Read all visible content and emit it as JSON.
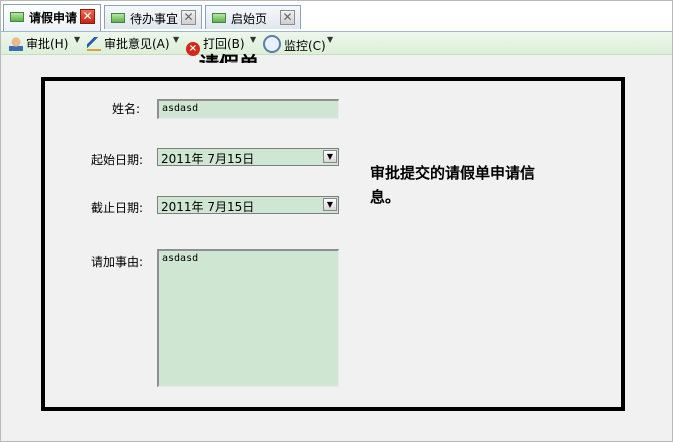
{
  "tabs": [
    {
      "label": "请假申请",
      "close": "✕"
    },
    {
      "label": "待办事宜",
      "close": "✕"
    },
    {
      "label": "启始页",
      "close": "✕"
    }
  ],
  "toolbar": {
    "approve": "审批(H)",
    "opinion": "审批意见(A)",
    "reject": "打回(B)",
    "monitor": "监控(C)",
    "dropdown_glyph": "▼"
  },
  "form": {
    "title": "请假单",
    "name_label": "姓名:",
    "name_value": "asdasd",
    "start_label": "起始日期:",
    "start_value": "2011年 7月15日",
    "end_label": "截止日期:",
    "end_value": "2011年 7月15日",
    "reason_label": "请加事由:",
    "reason_value": "asdasd",
    "note": "审批提交的请假单申请信息。"
  },
  "colors": {
    "field_bg": "#cfe7d2",
    "toolbar_bg": "#dcefd8",
    "panel_border": "#000000"
  }
}
